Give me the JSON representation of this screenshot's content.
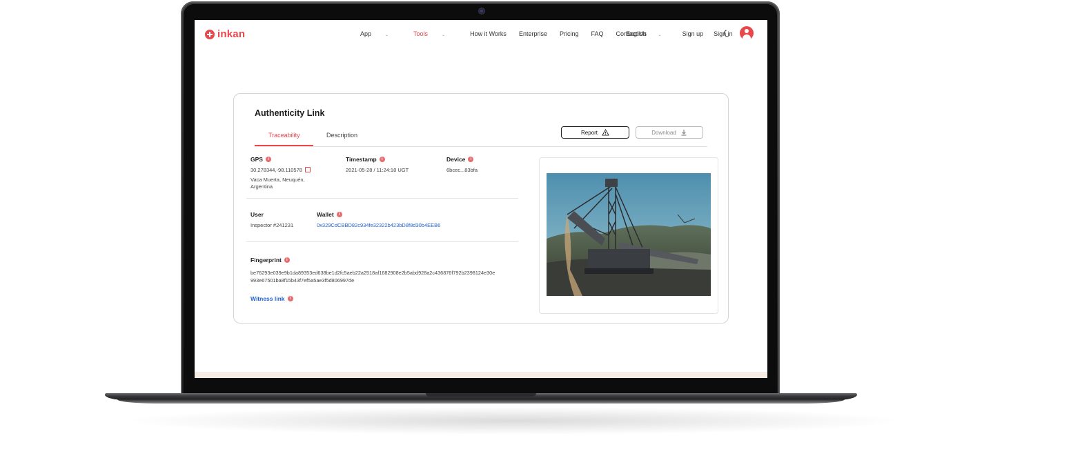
{
  "nav": {
    "logo": "inkan",
    "links": [
      {
        "label": "App",
        "dropdown": true
      },
      {
        "label": "Tools",
        "dropdown": true,
        "active": true
      },
      {
        "label": "How it Works"
      },
      {
        "label": "Enterprise"
      },
      {
        "label": "Pricing"
      },
      {
        "label": "FAQ"
      },
      {
        "label": "Contact Us"
      }
    ],
    "language": "English",
    "sign_up": "Sign up",
    "sign_in": "Sign in"
  },
  "card": {
    "title": "Authenticity Link",
    "tabs": [
      "Traceability",
      "Description"
    ],
    "report_label": "Report",
    "download_label": "Download",
    "gps": {
      "label": "GPS",
      "coords": "30.278344,-98.110578",
      "place_line1": "Vaca Muerta, Neuquén,",
      "place_line2": "Argentina"
    },
    "timestamp": {
      "label": "Timestamp",
      "value": "2021-05-28 / 11:24:18 UGT"
    },
    "device": {
      "label": "Device",
      "value": "6bcec...83bfa"
    },
    "user": {
      "label": "User",
      "value": "Inspector #241231"
    },
    "wallet": {
      "label": "Wallet",
      "value": "0x329CdCBBD82c934fe32322b423bD8f8d30b4EEB6"
    },
    "fingerprint": {
      "label": "Fingerprint",
      "line1": "be76293e039e9b1da89353ed638be1d2fc5aeb22a2518af1682908e2b5abd928a2c436876f792b2398124e30e",
      "line2": "993e67501ba8f15b43f7ef5a5ae3f5d806997de"
    },
    "witness_link": "Witness link"
  },
  "colors": {
    "accent": "#e8474c",
    "link": "#1f5fcf"
  },
  "icons": [
    "logo-icon",
    "chevron-down-icon",
    "moon-icon",
    "user-avatar-icon",
    "warning-icon",
    "download-icon",
    "info-icon",
    "copy-icon"
  ]
}
